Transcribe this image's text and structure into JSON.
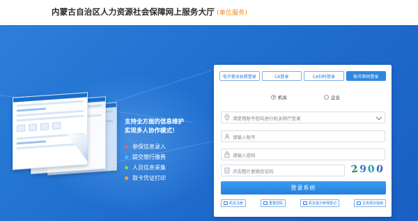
{
  "header": {
    "title": "内蒙古自治区人力资源社会保障网上服务大厅",
    "tag": "(单位服务)"
  },
  "promo": {
    "title_line1": "支持全方面的信息维护",
    "title_line2": "实现多人协作模式！",
    "features": [
      {
        "label": "参保信息录入",
        "color": "#f0615c"
      },
      {
        "label": "提交银行缴费",
        "color": "#47b5ff"
      },
      {
        "label": "人员信息采集",
        "color": "#8bd44a"
      },
      {
        "label": "取卡凭证打印",
        "color": "#f6a23a"
      }
    ]
  },
  "login": {
    "tabs": [
      "电子营业执照登录",
      "CA登录",
      "CA扫码登录",
      "账号密码登录"
    ],
    "active_tab": "账号密码登录",
    "radio_options": [
      {
        "label": "机关",
        "checked": true
      },
      {
        "label": "企业",
        "checked": false
      }
    ],
    "org_select_placeholder": "请使用账号密码进行机关网厅登录",
    "account_placeholder": "请输入账号",
    "password_placeholder": "请输入密码",
    "captcha_placeholder": "点击图片更换验证码",
    "captcha_text": "2900",
    "login_button": "登录系统",
    "bottom_links": [
      "机关注册",
      "重置密码",
      "机关首次参保登记",
      "业务经办指南"
    ]
  },
  "colors": {
    "accent": "#2f88e0",
    "hero_bg": "#1f6fd0",
    "tag_orange": "#f08a1a"
  }
}
